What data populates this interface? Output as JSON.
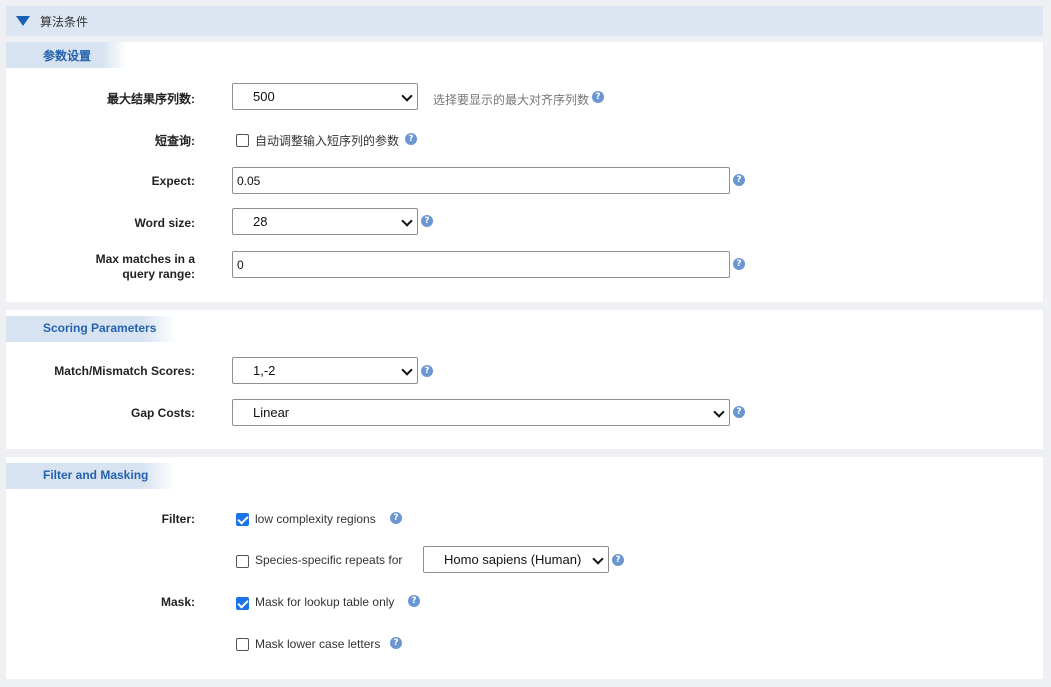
{
  "header": {
    "title": "算法条件"
  },
  "sections": {
    "general": {
      "title": "参数设置",
      "max_results_label": "最大结果序列数:",
      "max_results_value": "500",
      "max_results_hint": "选择要显示的最大对齐序列数",
      "short_query_label": "短查询:",
      "short_query_checkbox_label": "自动调整输入短序列的参数",
      "short_query_checked": false,
      "expect_label": "Expect:",
      "expect_value": "0.05",
      "word_size_label": "Word size:",
      "word_size_value": "28",
      "max_matches_label_line1": "Max matches in a",
      "max_matches_label_line2": "query range:",
      "max_matches_value": "0"
    },
    "scoring": {
      "title": "Scoring Parameters",
      "match_mismatch_label": "Match/Mismatch Scores:",
      "match_mismatch_value": "1,-2",
      "gap_costs_label": "Gap Costs:",
      "gap_costs_value": "Linear"
    },
    "filter": {
      "title": "Filter and Masking",
      "filter_label": "Filter:",
      "low_complexity_label": "low complexity regions",
      "low_complexity_checked": true,
      "species_repeats_label": "Species-specific repeats for",
      "species_repeats_checked": false,
      "species_value": "Homo sapiens (Human)",
      "mask_label": "Mask:",
      "mask_lookup_label": "Mask for lookup table only",
      "mask_lookup_checked": true,
      "mask_lower_label": "Mask lower case letters",
      "mask_lower_checked": false
    }
  },
  "icons": {
    "help": "?",
    "help_icon_color": "#6a96d2",
    "accent": "#1b5fb4"
  }
}
